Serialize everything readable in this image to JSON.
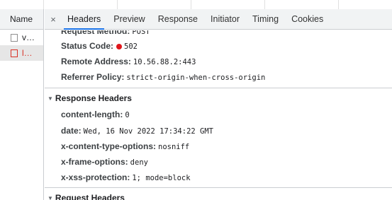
{
  "requests": {
    "header": "Name",
    "items": [
      {
        "name": "v…",
        "selected": false
      },
      {
        "name": "l…",
        "selected": true
      }
    ]
  },
  "tabs": {
    "close_glyph": "×",
    "items": [
      {
        "label": "Headers",
        "active": true
      },
      {
        "label": "Preview",
        "active": false
      },
      {
        "label": "Response",
        "active": false
      },
      {
        "label": "Initiator",
        "active": false
      },
      {
        "label": "Timing",
        "active": false
      },
      {
        "label": "Cookies",
        "active": false
      }
    ]
  },
  "general": {
    "request_method": {
      "key": "Request Method:",
      "value": "POST"
    },
    "status_code": {
      "key": "Status Code:",
      "value": "502",
      "dot_color": "#e0161b"
    },
    "remote_address": {
      "key": "Remote Address:",
      "value": "10.56.88.2:443"
    },
    "referrer_policy": {
      "key": "Referrer Policy:",
      "value": "strict-origin-when-cross-origin"
    }
  },
  "response_headers": {
    "title": "Response Headers",
    "items": [
      {
        "key": "content-length:",
        "value": "0"
      },
      {
        "key": "date:",
        "value": "Wed, 16 Nov 2022 17:34:22 GMT"
      },
      {
        "key": "x-content-type-options:",
        "value": "nosniff"
      },
      {
        "key": "x-frame-options:",
        "value": "deny"
      },
      {
        "key": "x-xss-protection:",
        "value": "1; mode=block"
      }
    ]
  },
  "request_headers": {
    "title": "Request Headers"
  }
}
